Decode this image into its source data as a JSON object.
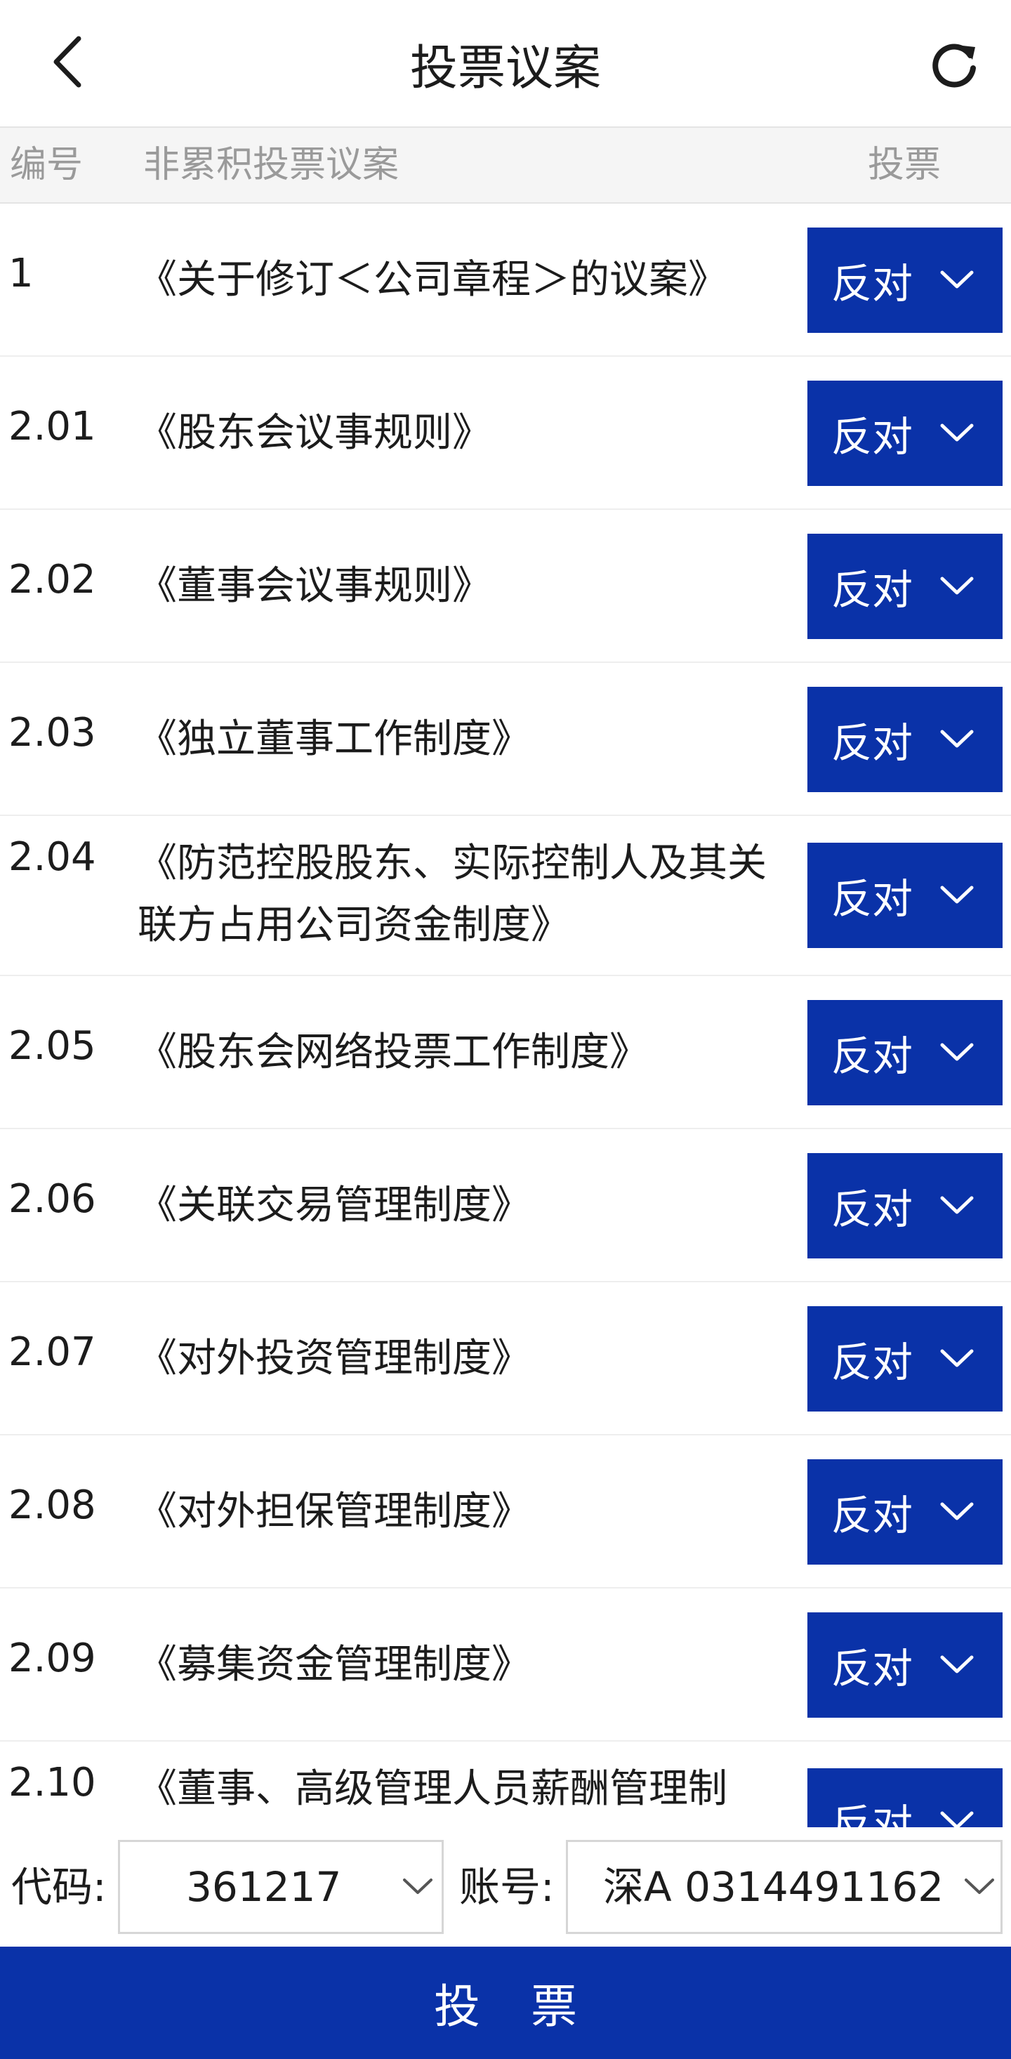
{
  "header": {
    "title": "投票议案",
    "back_icon": "chevron-left-icon",
    "refresh_icon": "refresh-icon"
  },
  "columns": {
    "number": "编号",
    "title": "非累积投票议案",
    "vote": "投票"
  },
  "proposals": [
    {
      "number": "1",
      "title": "《关于修订＜公司章程＞的议案》",
      "vote": "反对"
    },
    {
      "number": "2.01",
      "title": "《股东会议事规则》",
      "vote": "反对"
    },
    {
      "number": "2.02",
      "title": "《董事会议事规则》",
      "vote": "反对"
    },
    {
      "number": "2.03",
      "title": "《独立董事工作制度》",
      "vote": "反对"
    },
    {
      "number": "2.04",
      "title": "《防范控股股东、实际控制人及其关联方占用公司资金制度》",
      "vote": "反对"
    },
    {
      "number": "2.05",
      "title": "《股东会网络投票工作制度》",
      "vote": "反对"
    },
    {
      "number": "2.06",
      "title": "《关联交易管理制度》",
      "vote": "反对"
    },
    {
      "number": "2.07",
      "title": "《对外投资管理制度》",
      "vote": "反对"
    },
    {
      "number": "2.08",
      "title": "《对外担保管理制度》",
      "vote": "反对"
    },
    {
      "number": "2.09",
      "title": "《募集资金管理制度》",
      "vote": "反对"
    },
    {
      "number": "2.10",
      "title": "《董事、高级管理人员薪酬管理制",
      "vote": "反对"
    }
  ],
  "form": {
    "code_label": "代码:",
    "code_value": "361217",
    "account_label": "账号:",
    "account_value": "深A 0314491162"
  },
  "submit_label": "投票",
  "colors": {
    "primary": "#0a32a8",
    "header_bg": "#f5f5f5",
    "muted_text": "#9a9a9a"
  }
}
